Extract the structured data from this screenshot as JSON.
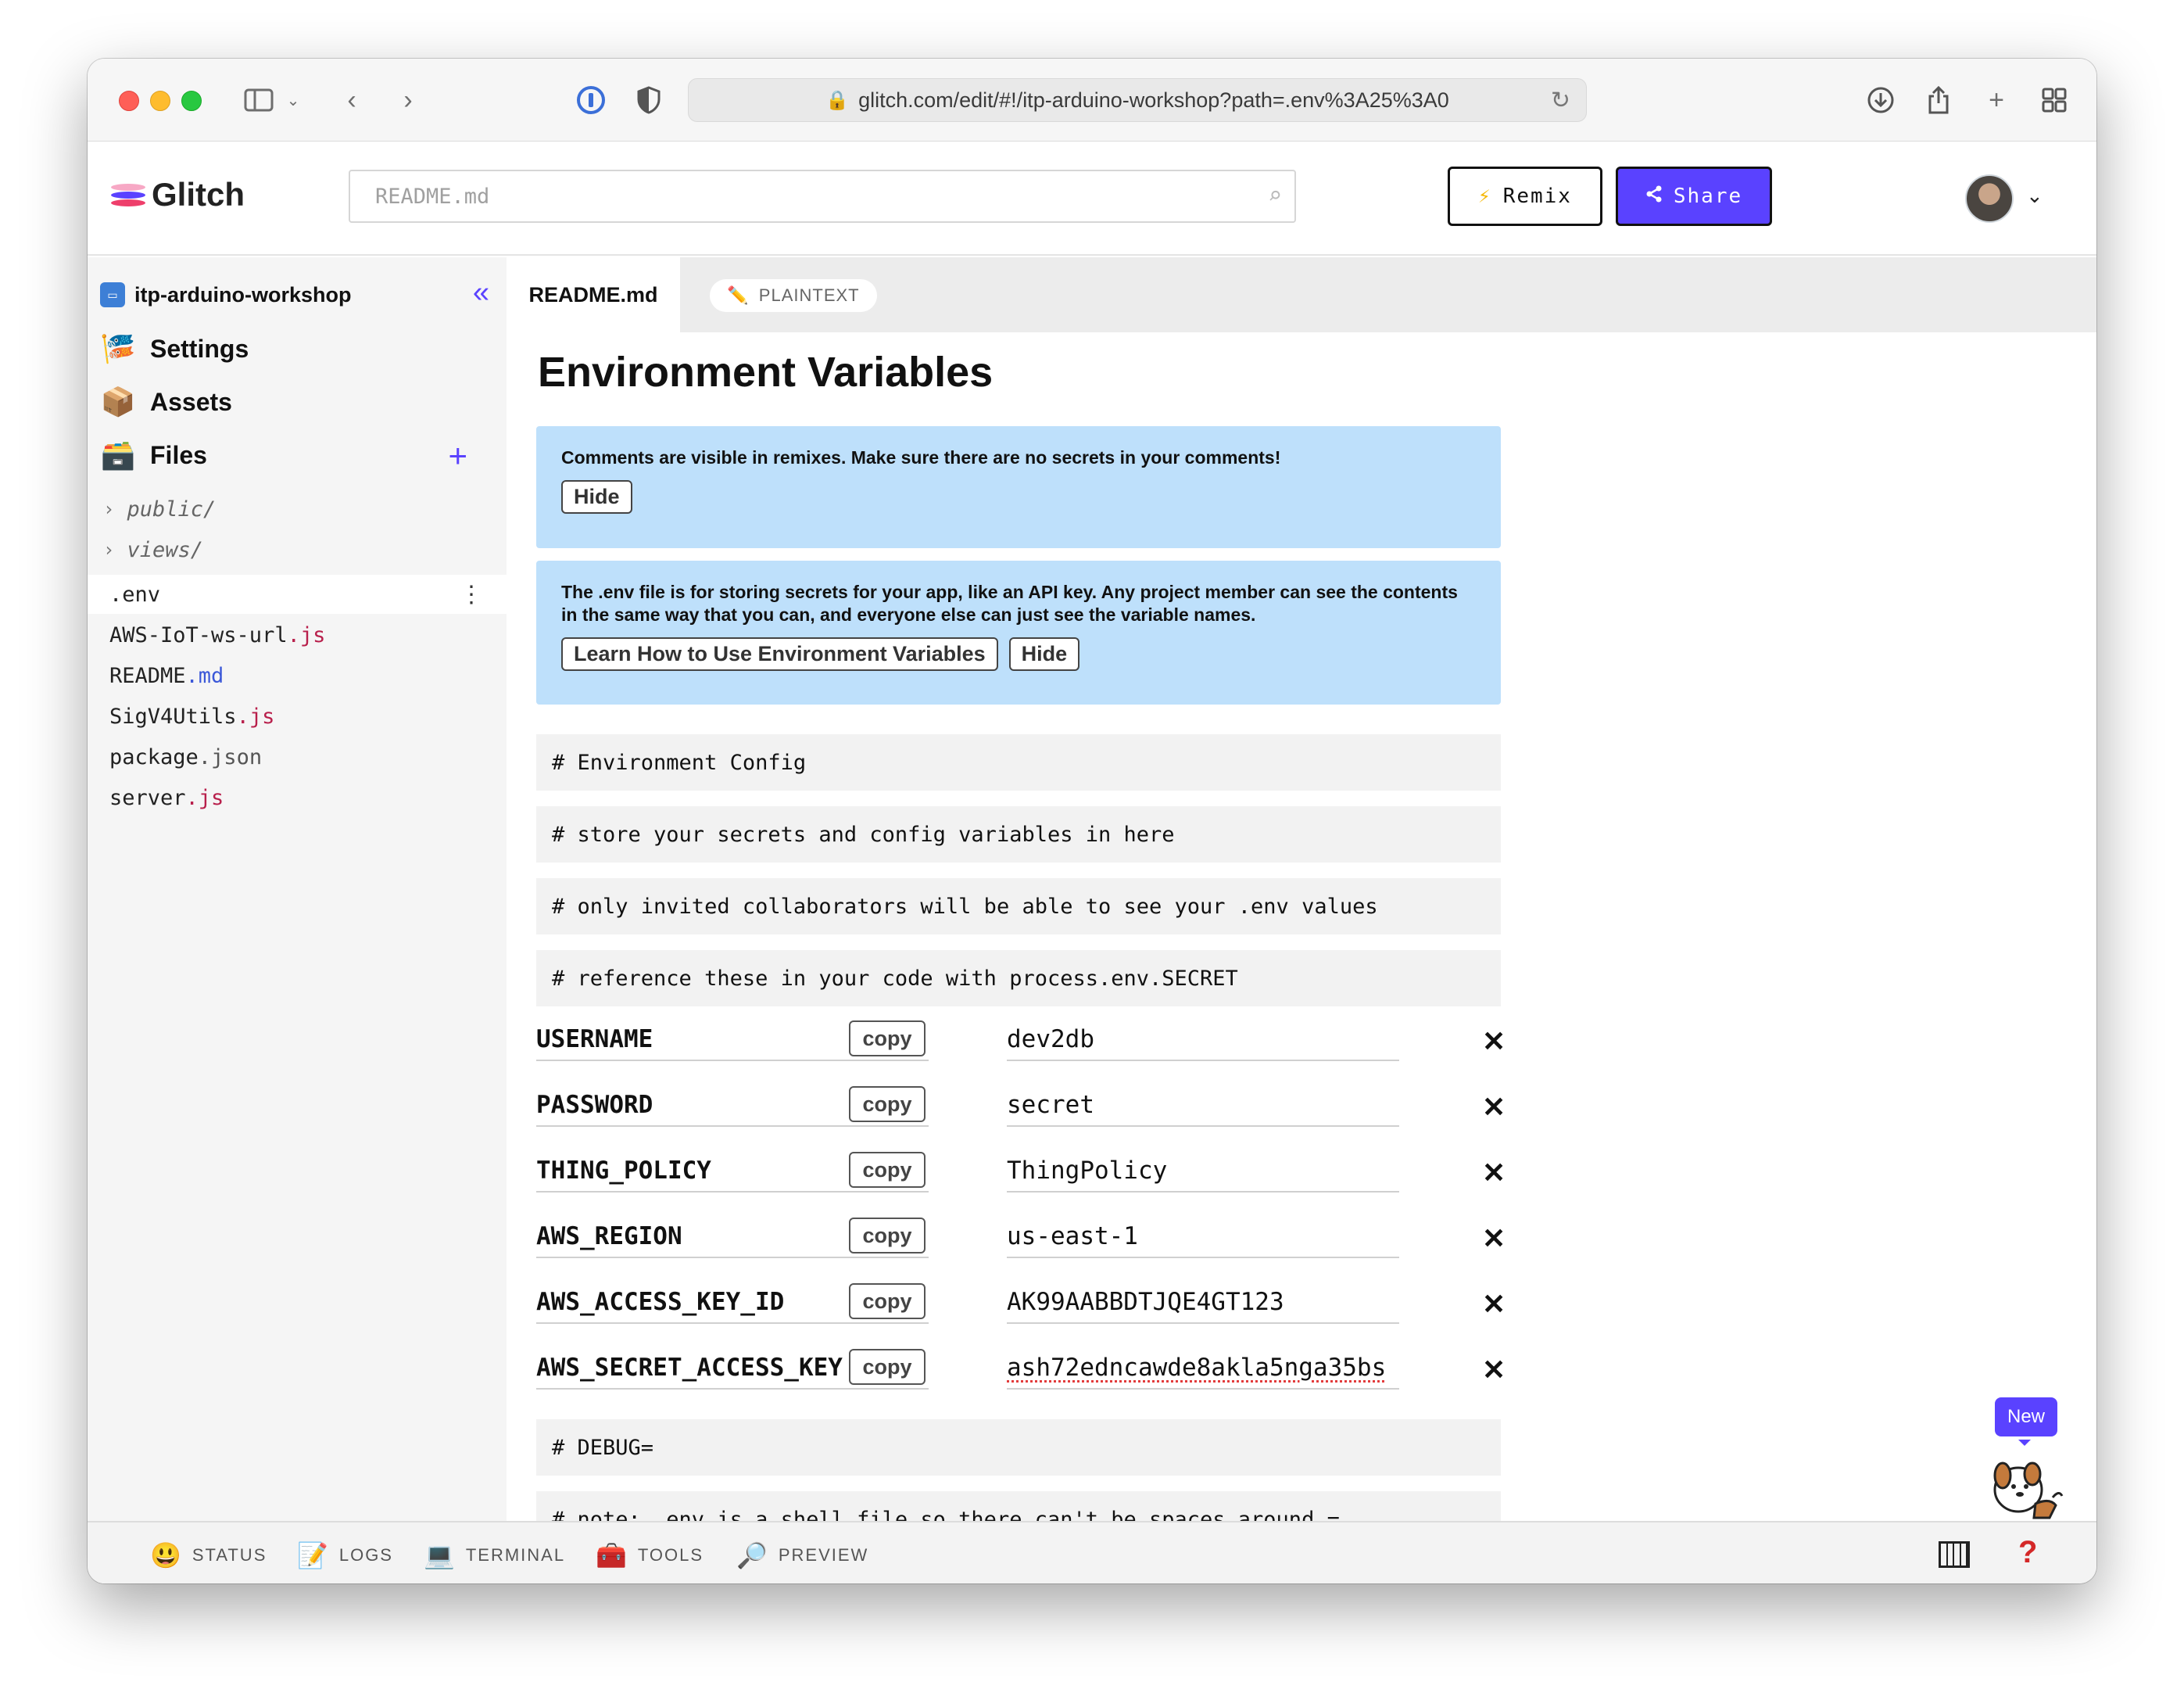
{
  "browser": {
    "url": "glitch.com/edit/#!/itp-arduino-workshop?path=.env%3A25%3A0"
  },
  "header": {
    "logo_text": "Glitch",
    "search_placeholder": "README.md",
    "remix_label": "Remix",
    "share_label": "Share"
  },
  "sidebar": {
    "project_name": "itp-arduino-workshop",
    "nav": [
      {
        "label": "Settings",
        "icon": "fish-icon"
      },
      {
        "label": "Assets",
        "icon": "box-icon"
      },
      {
        "label": "Files",
        "icon": "file-box-icon"
      }
    ],
    "folders": [
      "public/",
      "views/"
    ],
    "files": [
      {
        "base": ".env",
        "ext": "",
        "ext_type": "",
        "active": true
      },
      {
        "base": "AWS-IoT-ws-url",
        "ext": ".js",
        "ext_type": "js"
      },
      {
        "base": "README",
        "ext": ".md",
        "ext_type": "md"
      },
      {
        "base": "SigV4Utils",
        "ext": ".js",
        "ext_type": "js"
      },
      {
        "base": "package",
        "ext": ".json",
        "ext_type": "json"
      },
      {
        "base": "server",
        "ext": ".js",
        "ext_type": "js"
      }
    ]
  },
  "tabs": {
    "active": "README.md",
    "mode": "PLAINTEXT"
  },
  "env": {
    "title": "Environment Variables",
    "notice1": {
      "text": "Comments are visible in remixes. Make sure there are no secrets in your comments!",
      "hide_label": "Hide"
    },
    "notice2": {
      "text": "The .env file is for storing secrets for your app, like an API key. Any project member can see the contents in the same way that you can, and everyone else can just see the variable names.",
      "learn_label": "Learn How to Use Environment Variables",
      "hide_label": "Hide"
    },
    "comments": [
      "# Environment Config",
      "# store your secrets and config variables in here",
      "# only invited collaborators will be able to see your .env values",
      "# reference these in your code with process.env.SECRET"
    ],
    "copy_label": "copy",
    "delete_glyph": "✕",
    "variables": [
      {
        "key": "USERNAME",
        "value": "dev2db"
      },
      {
        "key": "PASSWORD",
        "value": "secret"
      },
      {
        "key": "THING_POLICY",
        "value": "ThingPolicy"
      },
      {
        "key": "AWS_REGION",
        "value": "us-east-1"
      },
      {
        "key": "AWS_ACCESS_KEY_ID",
        "value": "AK99AABBDTJQE4GT123"
      },
      {
        "key": "AWS_SECRET_ACCESS_KEY",
        "value": "ash72edncawde8akla5nga35bs"
      }
    ],
    "trailing_comments": [
      "# DEBUG=",
      "# note: .env is a shell file so there can't be spaces around ="
    ]
  },
  "footer": {
    "items": [
      {
        "label": "STATUS",
        "icon": "smiley-icon"
      },
      {
        "label": "LOGS",
        "icon": "memo-icon"
      },
      {
        "label": "TERMINAL",
        "icon": "laptop-icon"
      },
      {
        "label": "TOOLS",
        "icon": "toolbox-icon"
      },
      {
        "label": "PREVIEW",
        "icon": "magnifier-icon"
      }
    ]
  },
  "mascot": {
    "badge": "New"
  },
  "colors": {
    "accent": "#5a42ff",
    "notice_bg": "#bee0fb",
    "js_ext": "#b81f4b",
    "md_ext": "#3b58d8"
  }
}
